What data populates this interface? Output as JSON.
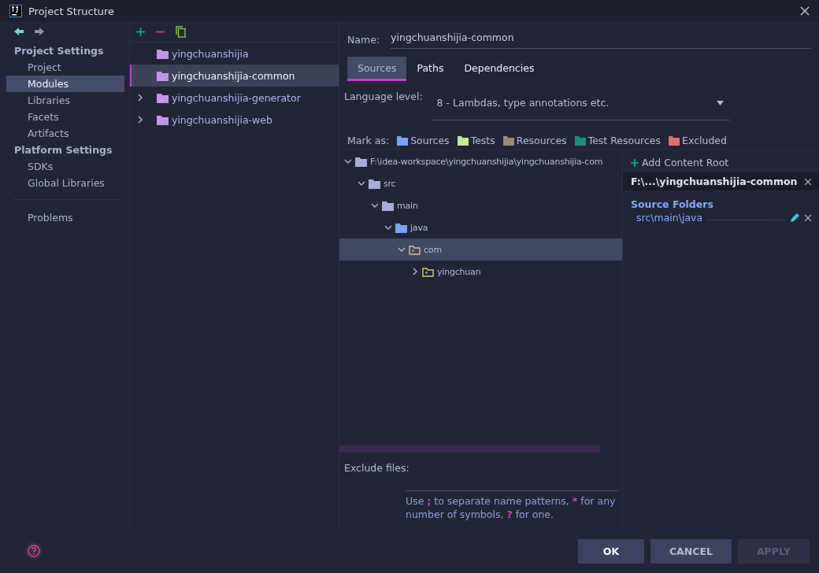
{
  "window": {
    "title": "Project Structure"
  },
  "sidebar": {
    "groups": [
      {
        "title": "Project Settings",
        "items": [
          {
            "label": "Project",
            "selected": false
          },
          {
            "label": "Modules",
            "selected": true
          },
          {
            "label": "Libraries",
            "selected": false
          },
          {
            "label": "Facets",
            "selected": false
          },
          {
            "label": "Artifacts",
            "selected": false
          }
        ]
      },
      {
        "title": "Platform Settings",
        "items": [
          {
            "label": "SDKs",
            "selected": false
          },
          {
            "label": "Global Libraries",
            "selected": false
          }
        ]
      }
    ],
    "extra": [
      {
        "label": "Problems",
        "selected": false
      }
    ]
  },
  "modules": [
    {
      "name": "yingchuanshijia",
      "selected": false,
      "expandable": false
    },
    {
      "name": "yingchuanshijia-common",
      "selected": true,
      "expandable": false
    },
    {
      "name": "yingchuanshijia-generator",
      "selected": false,
      "expandable": true
    },
    {
      "name": "yingchuanshijia-web",
      "selected": false,
      "expandable": true
    }
  ],
  "name_field": {
    "label": "Name:",
    "value": "yingchuanshijia-common"
  },
  "tabs": [
    {
      "label": "Sources",
      "selected": true
    },
    {
      "label": "Paths",
      "selected": false
    },
    {
      "label": "Dependencies",
      "selected": false
    }
  ],
  "language_level": {
    "label": "Language level:",
    "value": "8 - Lambdas, type annotations etc."
  },
  "mark_as": {
    "label": "Mark as:",
    "options": [
      {
        "label": "Sources",
        "color": "#7aa2f7"
      },
      {
        "label": "Tests",
        "color": "#c3e88d"
      },
      {
        "label": "Resources",
        "color": "#a08878"
      },
      {
        "label": "Test Resources",
        "color": "#1a8f7f"
      },
      {
        "label": "Excluded",
        "color": "#e06c75"
      }
    ]
  },
  "tree": [
    {
      "label": "F:\\idea-workspace\\yingchuanshijia\\yingchuanshijia-com",
      "kind": "plain",
      "expanded": true,
      "selected": false,
      "children": [
        {
          "label": "src",
          "kind": "plain",
          "expanded": true,
          "selected": false,
          "children": [
            {
              "label": "main",
              "kind": "plain",
              "expanded": true,
              "selected": false,
              "children": [
                {
                  "label": "java",
                  "kind": "source",
                  "expanded": true,
                  "selected": false,
                  "children": [
                    {
                      "label": "com",
                      "kind": "package",
                      "expanded": true,
                      "selected": true,
                      "children": [
                        {
                          "label": "yingchuan",
                          "kind": "package",
                          "expanded": false,
                          "selected": false
                        }
                      ]
                    }
                  ]
                }
              ]
            }
          ]
        }
      ]
    }
  ],
  "content_root": {
    "add_label": "Add Content Root",
    "path": "F:\\...\\yingchuanshijia-common",
    "section": "Source Folders",
    "folders": [
      "src\\main\\java"
    ]
  },
  "exclude": {
    "label": "Exclude files:",
    "hint": [
      {
        "kind": "text",
        "text": "Use "
      },
      {
        "kind": "symbol",
        "text": ";"
      },
      {
        "kind": "text",
        "text": " to separate name patterns, "
      },
      {
        "kind": "symbol",
        "text": "*"
      },
      {
        "kind": "text",
        "text": " for any number of symbols, "
      },
      {
        "kind": "symbol",
        "text": "?"
      },
      {
        "kind": "text",
        "text": " for one."
      }
    ]
  },
  "buttons": [
    {
      "label": "OK",
      "disabled": false,
      "default": true
    },
    {
      "label": "CANCEL",
      "disabled": false,
      "default": false
    },
    {
      "label": "APPLY",
      "disabled": true,
      "default": false
    }
  ]
}
